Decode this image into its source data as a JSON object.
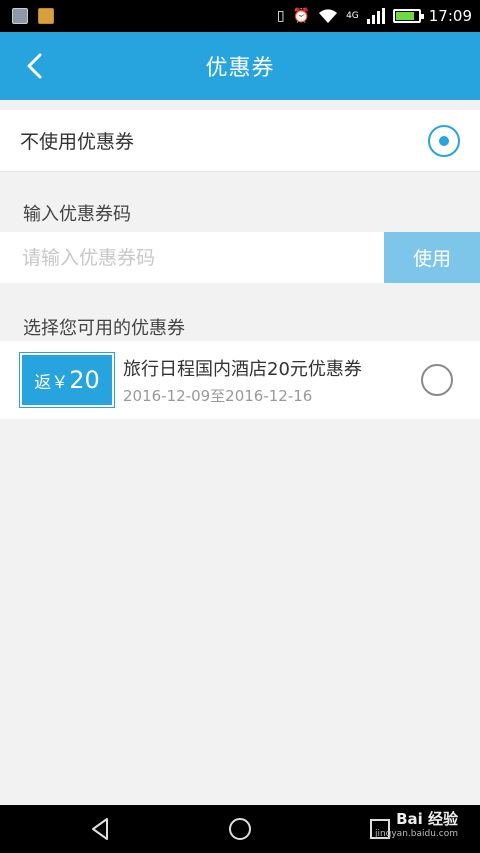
{
  "status_bar": {
    "network": "4G",
    "time": "17:09",
    "battery_level": 0.8
  },
  "header": {
    "title": "优惠券"
  },
  "no_coupon": {
    "label": "不使用优惠券",
    "selected": true
  },
  "coupon_code": {
    "section_title": "输入优惠券码",
    "placeholder": "请输入优惠券码",
    "use_label": "使用"
  },
  "available": {
    "section_title": "选择您可用的优惠券",
    "coupons": [
      {
        "badge_prefix": "返￥",
        "badge_amount": "20",
        "name": "旅行日程国内酒店20元优惠券",
        "valid_range": "2016-12-09至2016-12-16",
        "selected": false
      }
    ]
  },
  "watermark": {
    "logo": "Bai 经验",
    "url": "jingyan.baidu.com"
  },
  "colors": {
    "accent": "#27a3de",
    "use_button": "#7dc6ea",
    "background": "#f2f2f2"
  }
}
